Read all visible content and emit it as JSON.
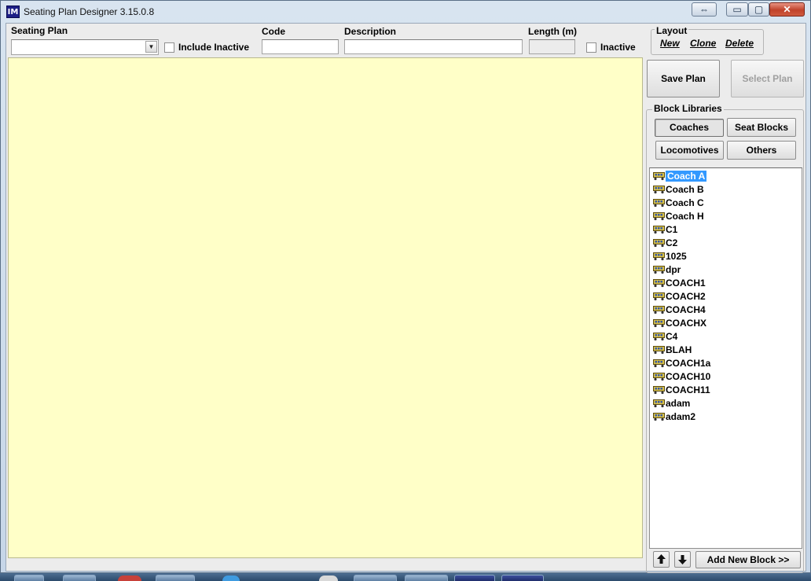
{
  "window": {
    "title": "Seating Plan Designer  3.15.0.8",
    "app_icon": "IM"
  },
  "titlebar": {
    "switch_icon": "⇔",
    "minimize": "▭",
    "maximize": "▢",
    "close": "✕"
  },
  "toolbar": {
    "seating_plan_label": "Seating Plan",
    "seating_plan_value": "",
    "include_inactive_label": "Include Inactive",
    "include_inactive_checked": false,
    "code_label": "Code",
    "code_value": "",
    "description_label": "Description",
    "description_value": "",
    "length_label": "Length (m)",
    "length_value": "",
    "inactive_label": "Inactive",
    "inactive_checked": false
  },
  "layout": {
    "title": "Layout",
    "new": "New",
    "clone": "Clone",
    "delete": "Delete"
  },
  "actions": {
    "save_plan": "Save Plan",
    "select_plan": "Select Plan"
  },
  "block_libraries": {
    "title": "Block Libraries",
    "coaches": "Coaches",
    "seat_blocks": "Seat Blocks",
    "locomotives": "Locomotives",
    "others": "Others",
    "items": [
      "Coach A",
      "Coach B",
      "Coach C",
      "Coach H",
      "C1",
      "C2",
      "1025",
      "dpr",
      "COACH1",
      "COACH2",
      "COACH4",
      "COACHX",
      "C4",
      "BLAH",
      "COACH1a",
      "COACH10",
      "COACH11",
      "adam",
      "adam2"
    ],
    "selected_item": "Coach A",
    "item_icon": "coach-block-icon",
    "add_new_block": "Add New Block >>"
  },
  "colors": {
    "canvas": "#ffffc8",
    "selection": "#3399ff",
    "window_frame": "#c6d6e8",
    "close_button": "#c0422a"
  }
}
